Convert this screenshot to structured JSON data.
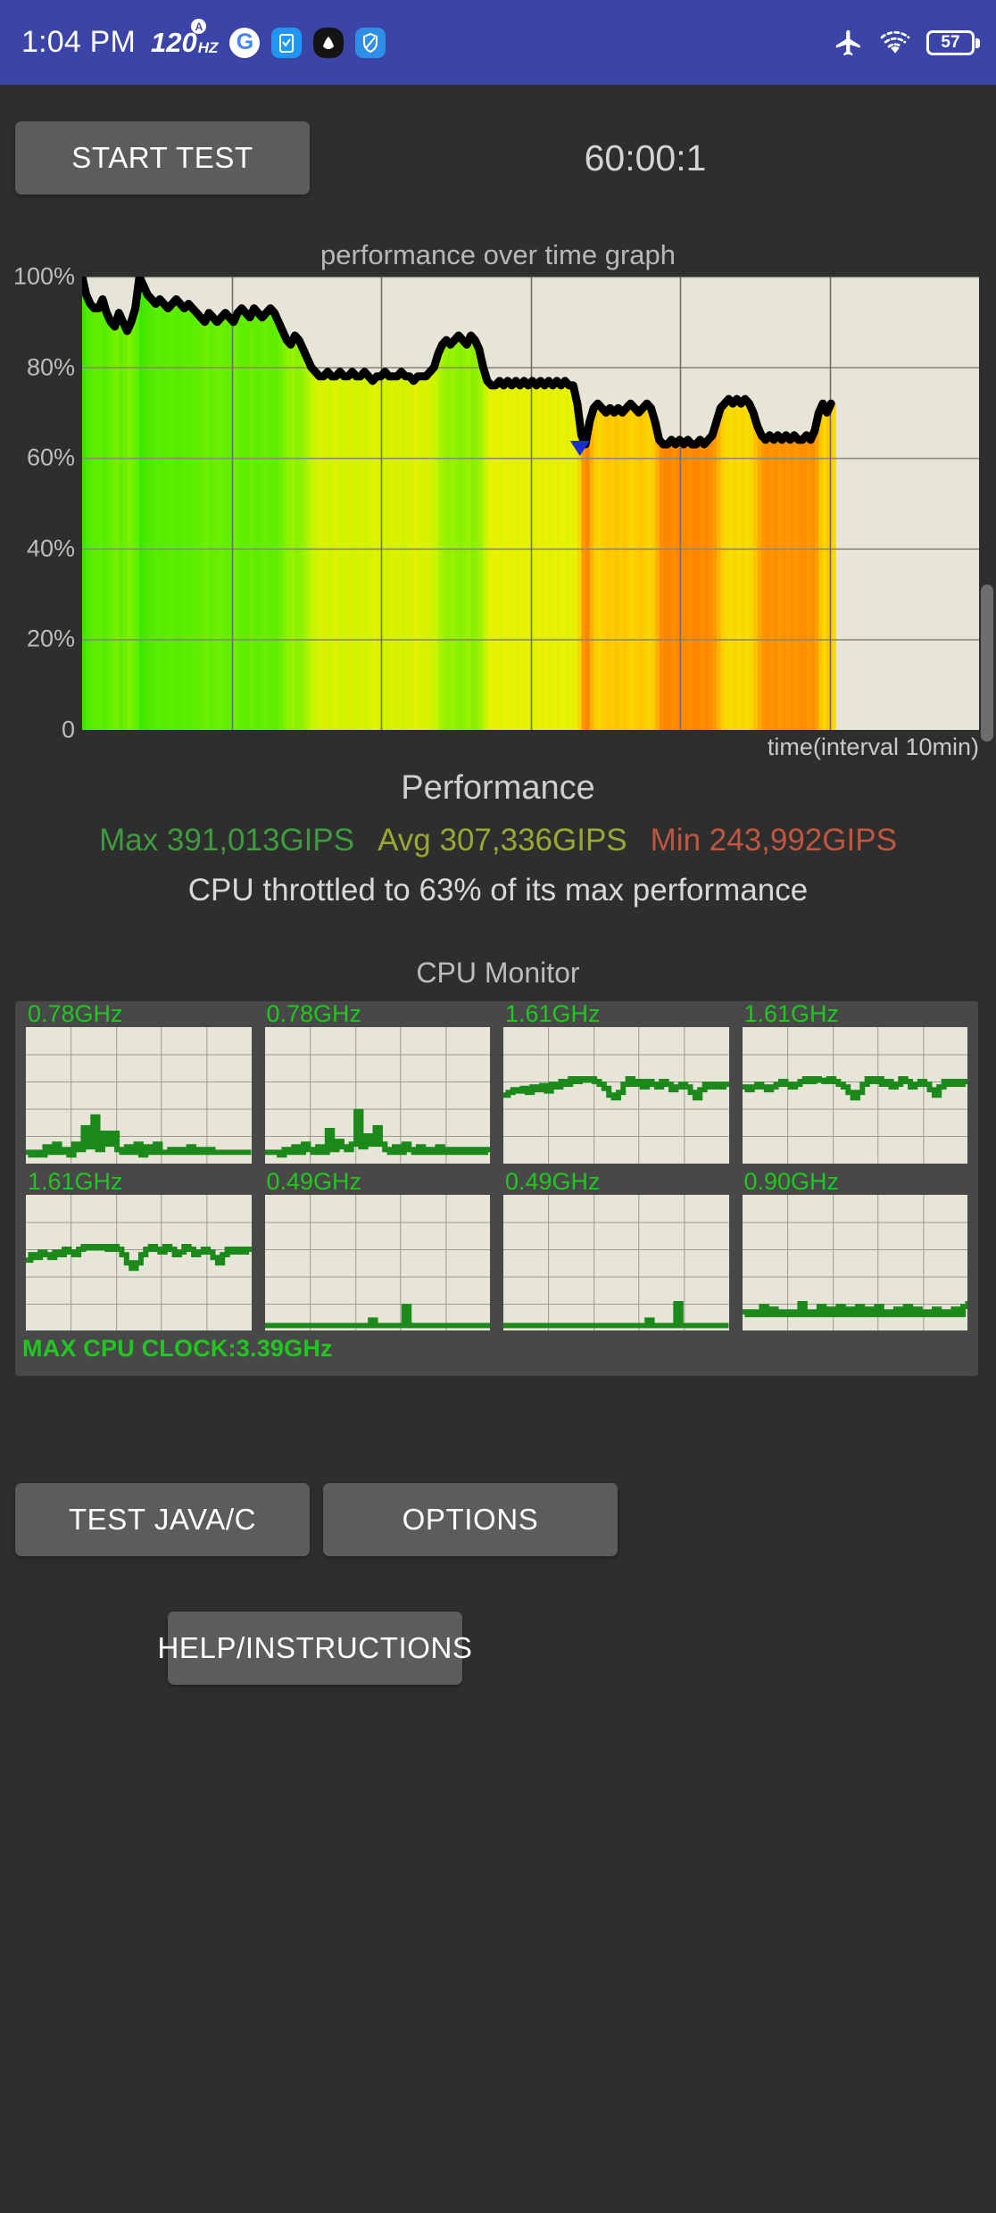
{
  "statusbar": {
    "clock": "1:04 PM",
    "refresh_rate": "120",
    "refresh_unit": "HZ",
    "refresh_badge": "A",
    "battery_percent": "57",
    "icons": [
      {
        "name": "google-icon",
        "glyph": "G"
      },
      {
        "name": "clipboard-icon",
        "glyph": "☑"
      },
      {
        "name": "app-dark-icon",
        "glyph": "◐"
      },
      {
        "name": "shield-icon",
        "glyph": "◗"
      },
      {
        "name": "airplane-mode-icon",
        "glyph": "✈"
      },
      {
        "name": "wifi-icon",
        "glyph": "▲"
      },
      {
        "name": "battery-icon",
        "glyph": "▭"
      }
    ]
  },
  "toolbar": {
    "start_label": "START TEST",
    "timer": "60:00:1"
  },
  "graph": {
    "title": "performance over time graph",
    "time_label": "time(interval 10min)"
  },
  "performance": {
    "heading": "Performance",
    "max_label": "Max 391,013GIPS",
    "avg_label": "Avg 307,336GIPS",
    "min_label": "Min 243,992GIPS",
    "throttle_text": "CPU throttled to 63% of its max performance",
    "max_value": 391013,
    "avg_value": 307336,
    "min_value": 243992,
    "throttle_percent": 63,
    "unit": "GIPS",
    "colors": {
      "max": "#3f9b3f",
      "avg": "#9aa832",
      "min": "#c1563e"
    }
  },
  "cpu_monitor": {
    "title": "CPU Monitor",
    "max_clock_label": "MAX CPU CLOCK:3.39GHz",
    "max_clock": "3.39GHz",
    "cores": [
      {
        "freq": "0.78GHz"
      },
      {
        "freq": "0.78GHz"
      },
      {
        "freq": "1.61GHz"
      },
      {
        "freq": "1.61GHz"
      },
      {
        "freq": "1.61GHz"
      },
      {
        "freq": "0.49GHz"
      },
      {
        "freq": "0.49GHz"
      },
      {
        "freq": "0.90GHz"
      }
    ]
  },
  "buttons": {
    "test_java_c": "TEST JAVA/C",
    "options": "OPTIONS",
    "help": "HELP/INSTRUCTIONS"
  },
  "chart_data": {
    "type": "area",
    "title": "performance over time graph",
    "xlabel": "time(interval 10min)",
    "ylabel": "",
    "ylim": [
      0,
      100
    ],
    "yticks": [
      0,
      20,
      40,
      60,
      80,
      100
    ],
    "ytick_labels": [
      "0",
      "20%",
      "40%",
      "60%",
      "80%",
      "100%"
    ],
    "grid": true,
    "x_gridline_count": 6,
    "data_span_fraction": 0.835,
    "min_marker": {
      "x_fraction": 0.555,
      "value": 63,
      "color": "#1b2fd0"
    },
    "line_color": "#000000",
    "plot_background": "#e6e5d7",
    "series": [
      {
        "name": "performance",
        "values": [
          100,
          96,
          94,
          93,
          93,
          95,
          92,
          90,
          89,
          92,
          90,
          88,
          90,
          93,
          100,
          98,
          96,
          95,
          94,
          95,
          94,
          93,
          94,
          95,
          94,
          93,
          94,
          93,
          92,
          91,
          90,
          92,
          91,
          90,
          91,
          92,
          91,
          90,
          92,
          93,
          92,
          91,
          93,
          92,
          91,
          92,
          93,
          92,
          90,
          88,
          86,
          85,
          87,
          86,
          84,
          82,
          80,
          79,
          78,
          78,
          79,
          78,
          78,
          79,
          78,
          78,
          79,
          78,
          78,
          79,
          78,
          77,
          78,
          78,
          79,
          78,
          78,
          78,
          79,
          78,
          78,
          77,
          78,
          78,
          78,
          79,
          80,
          83,
          85,
          86,
          85,
          86,
          87,
          86,
          85,
          87,
          86,
          84,
          80,
          77,
          76,
          76,
          77,
          76,
          77,
          76,
          77,
          76,
          77,
          76,
          77,
          76,
          77,
          76,
          77,
          76,
          77,
          76,
          77,
          76,
          76,
          72,
          65,
          63,
          68,
          71,
          72,
          71,
          70,
          71,
          70,
          71,
          70,
          71,
          72,
          71,
          70,
          71,
          72,
          71,
          68,
          64,
          63,
          63,
          64,
          63,
          64,
          63,
          64,
          63,
          63,
          64,
          63,
          64,
          65,
          68,
          71,
          72,
          73,
          72,
          73,
          72,
          73,
          72,
          70,
          67,
          65,
          64,
          65,
          64,
          65,
          64,
          65,
          64,
          65,
          64,
          64,
          65,
          64,
          66,
          70,
          72,
          70,
          72
        ]
      }
    ],
    "area_gradient": {
      "description": "per-sample vertical fill colored green to red by value",
      "stops": [
        {
          "value": 100,
          "color": "#3fe800"
        },
        {
          "value": 90,
          "color": "#6bf000"
        },
        {
          "value": 80,
          "color": "#c8f400"
        },
        {
          "value": 75,
          "color": "#f2f000"
        },
        {
          "value": 70,
          "color": "#ffc400"
        },
        {
          "value": 65,
          "color": "#ff9800"
        },
        {
          "value": 60,
          "color": "#ff6a00"
        }
      ]
    },
    "cpu_cores": [
      {
        "name": "core0",
        "freq": "0.78GHz",
        "values": [
          8,
          6,
          8,
          6,
          12,
          8,
          14,
          8,
          10,
          6,
          14,
          10,
          26,
          12,
          34,
          10,
          22,
          14,
          22,
          10,
          8,
          12,
          8,
          14,
          6,
          12,
          8,
          14,
          8,
          8,
          10,
          8,
          10,
          8,
          12,
          8,
          10,
          8,
          10,
          8,
          8,
          8,
          8,
          8,
          8,
          8,
          8,
          8
        ]
      },
      {
        "name": "core1",
        "freq": "0.78GHz",
        "values": [
          8,
          8,
          8,
          6,
          10,
          8,
          12,
          8,
          14,
          10,
          8,
          12,
          8,
          24,
          10,
          16,
          12,
          10,
          14,
          38,
          12,
          20,
          14,
          26,
          14,
          10,
          8,
          12,
          8,
          14,
          10,
          8,
          12,
          8,
          10,
          8,
          12,
          8,
          10,
          8,
          10,
          8,
          10,
          8,
          10,
          8,
          10,
          8
        ]
      },
      {
        "name": "core2",
        "freq": "1.61GHz",
        "values": [
          50,
          52,
          54,
          53,
          55,
          52,
          56,
          54,
          57,
          53,
          58,
          56,
          60,
          58,
          62,
          60,
          62,
          61,
          62,
          60,
          58,
          55,
          50,
          48,
          52,
          58,
          62,
          58,
          60,
          56,
          60,
          58,
          56,
          60,
          58,
          54,
          56,
          58,
          56,
          52,
          48,
          54,
          58,
          56,
          58,
          56,
          58,
          56
        ]
      },
      {
        "name": "core3",
        "freq": "1.61GHz",
        "values": [
          56,
          54,
          56,
          58,
          56,
          54,
          56,
          58,
          60,
          58,
          56,
          58,
          60,
          62,
          60,
          62,
          61,
          60,
          62,
          60,
          58,
          56,
          52,
          48,
          52,
          58,
          62,
          60,
          62,
          58,
          60,
          56,
          58,
          62,
          60,
          56,
          58,
          60,
          58,
          54,
          50,
          56,
          60,
          58,
          60,
          58,
          60,
          58
        ]
      },
      {
        "name": "core4",
        "freq": "1.61GHz",
        "values": [
          52,
          56,
          54,
          58,
          56,
          54,
          58,
          56,
          60,
          58,
          56,
          60,
          62,
          61,
          62,
          61,
          62,
          60,
          62,
          60,
          56,
          50,
          46,
          50,
          56,
          60,
          62,
          60,
          58,
          62,
          60,
          56,
          58,
          62,
          60,
          56,
          58,
          60,
          58,
          54,
          50,
          56,
          60,
          58,
          60,
          58,
          60,
          58
        ]
      },
      {
        "name": "core5",
        "freq": "0.49GHz",
        "values": [
          4,
          4,
          4,
          4,
          4,
          4,
          4,
          4,
          4,
          4,
          4,
          4,
          4,
          4,
          4,
          4,
          4,
          4,
          4,
          4,
          4,
          4,
          8,
          4,
          4,
          4,
          4,
          4,
          4,
          18,
          4,
          4,
          4,
          4,
          4,
          4,
          4,
          4,
          4,
          4,
          4,
          4,
          4,
          4,
          4,
          4,
          4,
          4
        ]
      },
      {
        "name": "core6",
        "freq": "0.49GHz",
        "values": [
          4,
          4,
          4,
          4,
          4,
          4,
          4,
          4,
          4,
          4,
          4,
          4,
          4,
          4,
          4,
          4,
          4,
          4,
          4,
          4,
          4,
          4,
          4,
          4,
          4,
          4,
          4,
          4,
          4,
          4,
          8,
          4,
          4,
          4,
          4,
          4,
          20,
          4,
          4,
          4,
          4,
          4,
          4,
          4,
          4,
          4,
          4,
          4
        ]
      },
      {
        "name": "core7",
        "freq": "0.90GHz",
        "values": [
          14,
          12,
          14,
          12,
          18,
          12,
          16,
          12,
          14,
          12,
          14,
          12,
          20,
          12,
          14,
          12,
          18,
          12,
          16,
          12,
          18,
          12,
          16,
          12,
          18,
          12,
          16,
          12,
          18,
          12,
          14,
          12,
          16,
          12,
          18,
          12,
          16,
          12,
          14,
          12,
          16,
          12,
          14,
          12,
          16,
          12,
          18,
          22
        ]
      }
    ]
  }
}
